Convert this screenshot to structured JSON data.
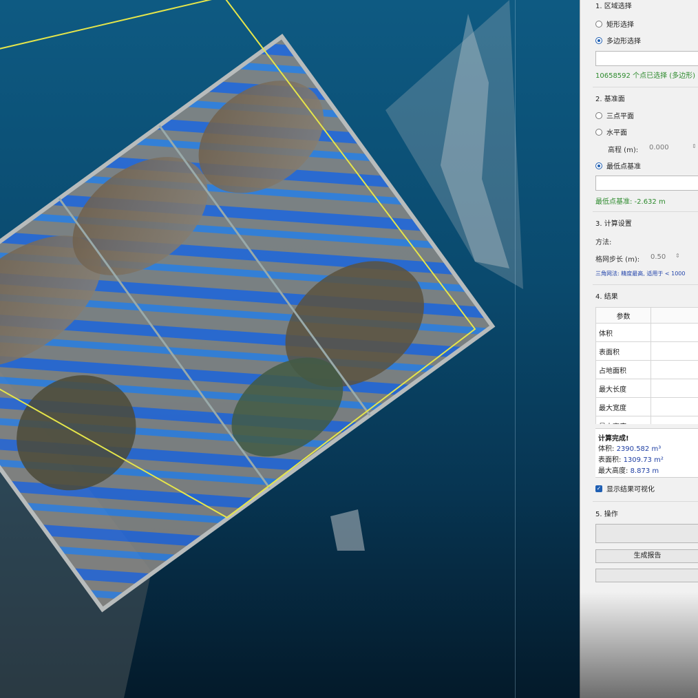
{
  "panel": {
    "sec1": {
      "title": "1. 区域选择",
      "opt_rect": "矩形选择",
      "opt_poly": "多边形选择",
      "status": "10658592 个点已选择 (多边形)"
    },
    "sec2": {
      "title": "2. 基准面",
      "opt_three": "三点平面",
      "opt_horizontal": "水平面",
      "elev_label": "高程 (m):",
      "elev_value": "0.000",
      "opt_lowest": "最低点基准",
      "status": "最低点基准: -2.632 m"
    },
    "sec3": {
      "title": "3. 计算设置",
      "method_label": "方法:",
      "grid_label": "格网步长 (m):",
      "grid_value": "0.50",
      "note": "三角网法: 精度最高, 适用于 < 1000"
    },
    "sec4": {
      "title": "4. 结果",
      "col_header": "参数",
      "rows": [
        "体积",
        "表面积",
        "占地面积",
        "最大长度",
        "最大宽度",
        "最大高度"
      ],
      "done_title": "计算完成!",
      "volume_label": "体积:",
      "volume_value": "2390.582 m³",
      "surface_label": "表面积:",
      "surface_value": "1309.73 m²",
      "height_label": "最大高度:",
      "height_value": "8.873 m",
      "visualize_label": "显示结果可视化"
    },
    "sec5": {
      "title": "5. 操作",
      "report_button": "生成报告"
    }
  },
  "colors": {
    "selection_outline": "#e6e64a",
    "status_green": "#2d8a2d",
    "value_blue": "#1f3fa3",
    "accent": "#1f5fb3"
  },
  "icons": {
    "visualize_check": "checkbox-checked-icon",
    "spin": "spin-arrows-icon"
  }
}
